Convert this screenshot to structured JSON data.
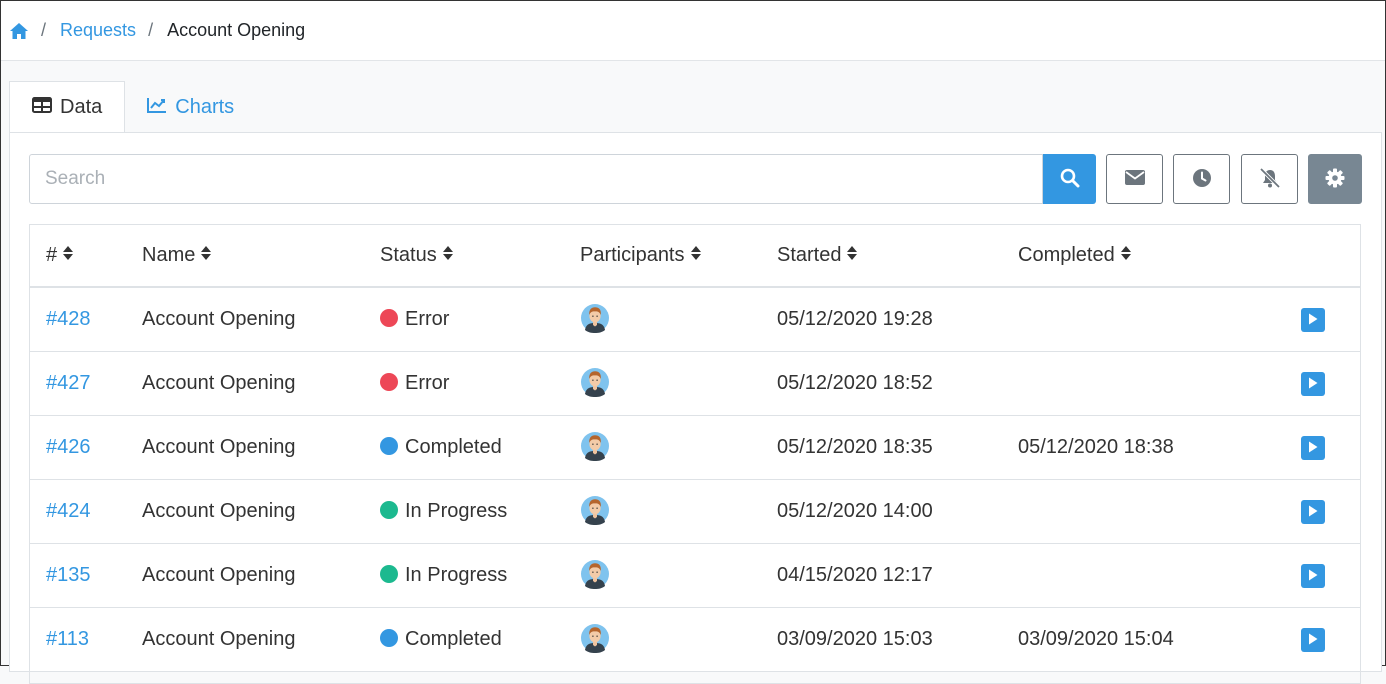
{
  "breadcrumb": {
    "link": "Requests",
    "current": "Account Opening",
    "separator": "/"
  },
  "tabs": [
    {
      "label": "Data",
      "icon": "table-icon",
      "active": true
    },
    {
      "label": "Charts",
      "icon": "line-chart-icon",
      "active": false
    }
  ],
  "search": {
    "placeholder": "Search",
    "value": ""
  },
  "toolbar_icons": [
    "search-icon",
    "envelope-icon",
    "clock-icon",
    "bell-slash-icon",
    "gear-icon"
  ],
  "table": {
    "columns": [
      "#",
      "Name",
      "Status",
      "Participants",
      "Started",
      "Completed"
    ],
    "rows": [
      {
        "id": "#428",
        "name": "Account Opening",
        "status": "Error",
        "status_color": "#ed4757",
        "started": "05/12/2020 19:28",
        "completed": ""
      },
      {
        "id": "#427",
        "name": "Account Opening",
        "status": "Error",
        "status_color": "#ed4757",
        "started": "05/12/2020 18:52",
        "completed": ""
      },
      {
        "id": "#426",
        "name": "Account Opening",
        "status": "Completed",
        "status_color": "#3397e1",
        "started": "05/12/2020 18:35",
        "completed": "05/12/2020 18:38"
      },
      {
        "id": "#424",
        "name": "Account Opening",
        "status": "In Progress",
        "status_color": "#1cb98f",
        "started": "05/12/2020 14:00",
        "completed": ""
      },
      {
        "id": "#135",
        "name": "Account Opening",
        "status": "In Progress",
        "status_color": "#1cb98f",
        "started": "04/15/2020 12:17",
        "completed": ""
      },
      {
        "id": "#113",
        "name": "Account Opening",
        "status": "Completed",
        "status_color": "#3397e1",
        "started": "03/09/2020 15:03",
        "completed": "03/09/2020 15:04"
      }
    ]
  },
  "colors": {
    "accent": "#3397e1",
    "settings_button": "#788793"
  }
}
